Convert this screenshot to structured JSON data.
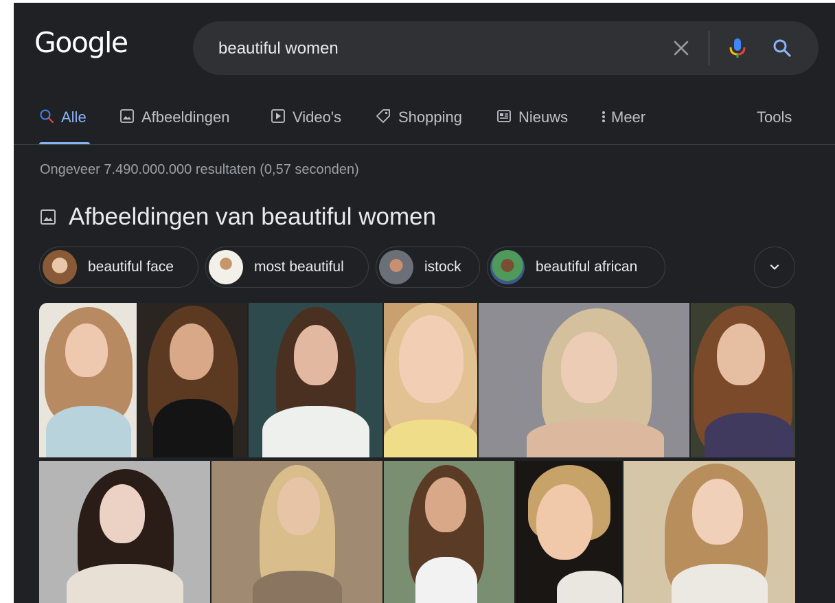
{
  "header": {
    "logo": "Google",
    "search": {
      "value": "beautiful women",
      "placeholder": ""
    }
  },
  "tabs": [
    {
      "label": "Alle",
      "icon": "search-icon",
      "active": true
    },
    {
      "label": "Afbeeldingen",
      "icon": "image-icon"
    },
    {
      "label": "Video's",
      "icon": "video-icon"
    },
    {
      "label": "Shopping",
      "icon": "tag-icon"
    },
    {
      "label": "Nieuws",
      "icon": "news-icon"
    },
    {
      "label": "Meer",
      "icon": "more-vert-icon"
    }
  ],
  "tools_label": "Tools",
  "result_stats": "Ongeveer 7.490.000.000 resultaten (0,57 seconden)",
  "images_section": {
    "heading": "Afbeeldingen van beautiful women",
    "chips": [
      {
        "label": "beautiful face"
      },
      {
        "label": "most beautiful"
      },
      {
        "label": "istock"
      },
      {
        "label": "beautiful african"
      }
    ]
  },
  "colors": {
    "background": "#202124",
    "searchbar": "#303134",
    "accent": "#8ab4f8",
    "text_primary": "#e8eaed",
    "text_secondary": "#bdc1c6"
  }
}
